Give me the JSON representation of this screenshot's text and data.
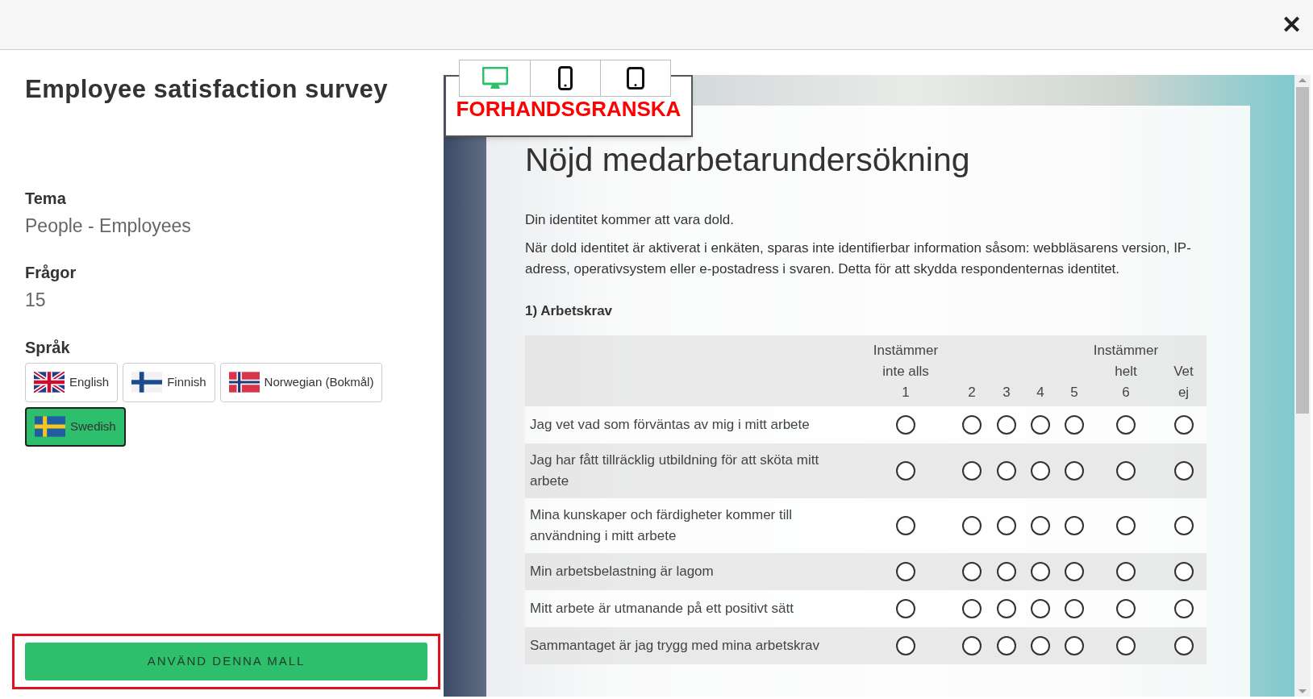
{
  "close_button": "✕",
  "survey": {
    "title": "Employee satisfaction survey",
    "theme_label": "Tema",
    "theme_value": "People - Employees",
    "questions_label": "Frågor",
    "questions_value": "15",
    "language_label": "Språk"
  },
  "languages": [
    {
      "label": "English",
      "kind": "uk",
      "selected": false
    },
    {
      "label": "Finnish",
      "kind": "fi",
      "selected": false
    },
    {
      "label": "Norwegian (Bokmål)",
      "kind": "no",
      "selected": false
    },
    {
      "label": "Swedish",
      "kind": "se",
      "selected": true
    }
  ],
  "use_template_button": "ANVÄND DENNA MALL",
  "device_tabs": [
    {
      "kind": "desktop",
      "selected": true
    },
    {
      "kind": "phone",
      "selected": false
    },
    {
      "kind": "tablet",
      "selected": false
    }
  ],
  "preview_label": "FORHANDSGRANSKA",
  "preview": {
    "title": "Nöjd medarbetarundersökning",
    "intro": [
      "Din identitet kommer att vara dold.",
      "När dold identitet är aktiverat i enkäten, sparas inte identifierbar information såsom: webbläsarens version, IP-adress, operativsystem eller e-postadress i svaren. Detta för att skydda respondenternas identitet."
    ],
    "question": "1) Arbetskrav",
    "columns": [
      [
        "Instämmer",
        "inte alls",
        "1"
      ],
      [
        "2"
      ],
      [
        "3"
      ],
      [
        "4"
      ],
      [
        "5"
      ],
      [
        "Instämmer",
        "helt",
        "6"
      ],
      [
        "Vet",
        "ej"
      ]
    ],
    "rows": [
      {
        "text": "Jag vet vad som förväntas av mig i mitt arbete",
        "options": [
          {
            "selected": false
          },
          {
            "selected": false
          },
          {
            "selected": false
          },
          {
            "selected": false
          },
          {
            "selected": false
          },
          {
            "selected": false
          },
          {
            "selected": false
          }
        ]
      },
      {
        "text": "Jag har fått tillräcklig utbildning för att sköta mitt arbete",
        "options": [
          {
            "selected": false
          },
          {
            "selected": false
          },
          {
            "selected": false
          },
          {
            "selected": false
          },
          {
            "selected": false
          },
          {
            "selected": false
          },
          {
            "selected": false
          }
        ]
      },
      {
        "text": "Mina kunskaper och färdigheter kommer till användning i mitt arbete",
        "options": [
          {
            "selected": false
          },
          {
            "selected": false
          },
          {
            "selected": false
          },
          {
            "selected": false
          },
          {
            "selected": false
          },
          {
            "selected": false
          },
          {
            "selected": false
          }
        ]
      },
      {
        "text": "Min arbetsbelastning är lagom",
        "options": [
          {
            "selected": false
          },
          {
            "selected": false
          },
          {
            "selected": false
          },
          {
            "selected": false
          },
          {
            "selected": false
          },
          {
            "selected": false
          },
          {
            "selected": false
          }
        ]
      },
      {
        "text": "Mitt arbete är utmanande på ett positivt sätt",
        "options": [
          {
            "selected": false
          },
          {
            "selected": false
          },
          {
            "selected": false
          },
          {
            "selected": false
          },
          {
            "selected": false
          },
          {
            "selected": false
          },
          {
            "selected": false
          }
        ]
      },
      {
        "text": "Sammantaget är jag trygg med mina arbetskrav",
        "options": [
          {
            "selected": false
          },
          {
            "selected": false
          },
          {
            "selected": false
          },
          {
            "selected": false
          },
          {
            "selected": false
          },
          {
            "selected": false
          },
          {
            "selected": false
          }
        ]
      }
    ]
  }
}
